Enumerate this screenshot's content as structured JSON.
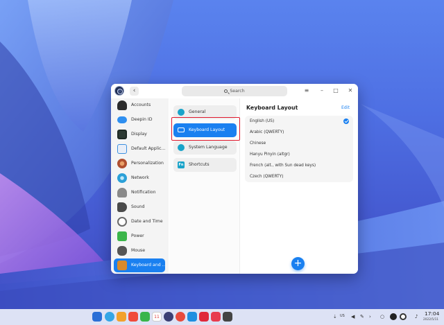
{
  "window": {
    "search_placeholder": "Search",
    "controls": {
      "menu": "≡",
      "minimize": "–",
      "maximize": "□",
      "close": "✕"
    }
  },
  "sidebar": {
    "items": [
      {
        "label": "Accounts",
        "icon": "accounts-icon",
        "color": "#2b2b2b"
      },
      {
        "label": "Deepin ID",
        "icon": "cloud-icon",
        "color": "#2f8ff0"
      },
      {
        "label": "Display",
        "icon": "display-icon",
        "color": "#2d3a33"
      },
      {
        "label": "Default Applic...",
        "icon": "default-apps-icon",
        "color": "#3a8fe0"
      },
      {
        "label": "Personalization",
        "icon": "personalization-icon",
        "color": "#b05030"
      },
      {
        "label": "Network",
        "icon": "network-icon",
        "color": "#2ba0d8"
      },
      {
        "label": "Notification",
        "icon": "notification-icon",
        "color": "#8a8a8a"
      },
      {
        "label": "Sound",
        "icon": "sound-icon",
        "color": "#4a4a4a"
      },
      {
        "label": "Date and Time",
        "icon": "clock-icon",
        "color": "#6a6a6a"
      },
      {
        "label": "Power",
        "icon": "power-icon",
        "color": "#3bb54a"
      },
      {
        "label": "Mouse",
        "icon": "mouse-icon",
        "color": "#555555"
      },
      {
        "label": "Keyboard and ...",
        "icon": "keyboard-icon",
        "color": "#d98a2b"
      }
    ]
  },
  "middle": {
    "items": [
      {
        "label": "General",
        "icon": "gear-icon",
        "color": "#19a3c9"
      },
      {
        "label": "Keyboard Layout",
        "icon": "keyboard-layout-icon",
        "color": "#ffffff"
      },
      {
        "label": "System Language",
        "icon": "language-icon",
        "color": "#19a3c9"
      },
      {
        "label": "Shortcuts",
        "icon": "shortcuts-icon",
        "color": "#19a3c9",
        "glyph": "Fn"
      }
    ]
  },
  "right": {
    "title": "Keyboard Layout",
    "edit_label": "Edit",
    "layouts": [
      "English (US)",
      "Arabic (QWERTY)",
      "Chinese",
      "Hanyu Pinyin (altgr)",
      "French (alt., with Sun dead keys)",
      "Czech (QWERTY)"
    ],
    "selected_index": 0,
    "add_label": "+"
  },
  "dock": {
    "apps": [
      {
        "name": "launcher-icon",
        "color": "#2b6fd6"
      },
      {
        "name": "multitask-icon",
        "color": "#34a6e6"
      },
      {
        "name": "file-manager-icon",
        "color": "#f2a12c"
      },
      {
        "name": "app-store-icon",
        "color": "#f04a3a"
      },
      {
        "name": "music-icon",
        "color": "#39b54a"
      },
      {
        "name": "calendar-icon",
        "color": "#ffffff"
      },
      {
        "name": "control-center-icon",
        "color": "#3b3f74"
      },
      {
        "name": "chrome-icon",
        "color": "#e84a3c"
      },
      {
        "name": "vscode-icon",
        "color": "#1f8fe0"
      },
      {
        "name": "wps-icon",
        "color": "#e0283a"
      },
      {
        "name": "screenshot-icon",
        "color": "#e83c4f"
      },
      {
        "name": "terminal-icon",
        "color": "#444444"
      }
    ],
    "calendar_glyph": "11",
    "keyboard_indicator": "US",
    "tray_glyphs": {
      "keyboard": "⇣",
      "volume": "◀",
      "pen": "✎",
      "chevron": "›",
      "search": "○",
      "notify": "♪"
    },
    "time": "17:04",
    "date": "2022/5/11"
  }
}
